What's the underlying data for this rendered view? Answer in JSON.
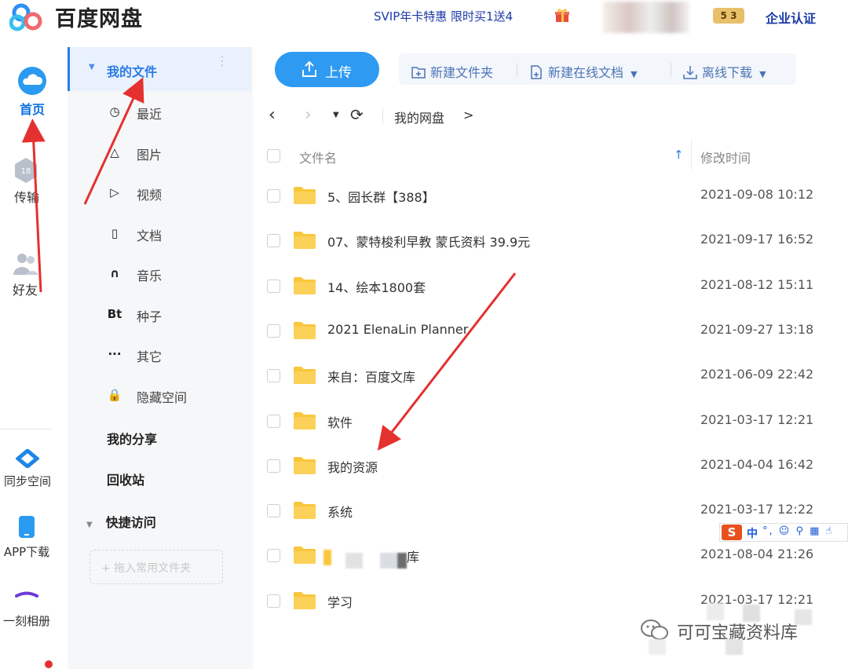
{
  "header": {
    "title": "百度网盘",
    "promo": "SVIP年卡特惠 限时买1送4",
    "vip_level": "5 3",
    "enterprise": "企业认证"
  },
  "leftnav": {
    "home": "首页",
    "transfer": "传输",
    "friends": "好友",
    "sync": "同步空间",
    "app_download": "APP下载",
    "album": "一刻相册"
  },
  "sidebar": {
    "my_files": "我的文件",
    "items": [
      {
        "icon": "clock-icon",
        "glyph": "◷",
        "label": "最近"
      },
      {
        "icon": "image-icon",
        "glyph": "△",
        "label": "图片"
      },
      {
        "icon": "video-icon",
        "glyph": "▷",
        "label": "视频"
      },
      {
        "icon": "document-icon",
        "glyph": "▯",
        "label": "文档"
      },
      {
        "icon": "headphones-icon",
        "glyph": "∩",
        "label": "音乐"
      },
      {
        "icon": "torrent-icon",
        "glyph": "Bt",
        "label": "种子"
      },
      {
        "icon": "more-icon",
        "glyph": "···",
        "label": "其它"
      },
      {
        "icon": "lock-icon",
        "glyph": "🔒",
        "label": "隐藏空间"
      }
    ],
    "my_share": "我的分享",
    "recycle": "回收站",
    "quick_access": "快捷访问",
    "drop_hint": "+ 拖入常用文件夹"
  },
  "toolbar": {
    "upload": "上传",
    "new_folder": "新建文件夹",
    "new_online_doc": "新建在线文档",
    "offline_download": "离线下载"
  },
  "breadcrumb": {
    "root": "我的网盘",
    "sep": ">"
  },
  "table": {
    "col_name": "文件名",
    "col_time": "修改时间",
    "rows": [
      {
        "name": "5、园长群【388】",
        "time": "2021-09-08 10:12"
      },
      {
        "name": "07、蒙特梭利早教 蒙氏资料 39.9元",
        "time": "2021-09-17 16:52"
      },
      {
        "name": "14、绘本1800套",
        "time": "2021-08-12 15:11"
      },
      {
        "name": "2021 ElenaLin Planner",
        "time": "2021-09-27 13:18"
      },
      {
        "name": "来自：百度文库",
        "time": "2021-06-09 22:42"
      },
      {
        "name": "软件",
        "time": "2021-03-17 12:21"
      },
      {
        "name": "我的资源",
        "time": "2021-04-04 16:42"
      },
      {
        "name": "系统",
        "time": "2021-03-17 12:22"
      },
      {
        "name": "库",
        "time": "2021-08-04 21:26"
      },
      {
        "name": "学习",
        "time": "2021-03-17 12:21"
      }
    ]
  },
  "ime": {
    "logo": "S",
    "mode": "中",
    "extras": "°, ☺ ⚲ ▦ ☝"
  },
  "watermark": "可可宝藏资料库",
  "colors": {
    "accent": "#2f9af2",
    "link": "#1c3aa8",
    "folder": "#f9c63c",
    "arrow": "#e53030"
  }
}
